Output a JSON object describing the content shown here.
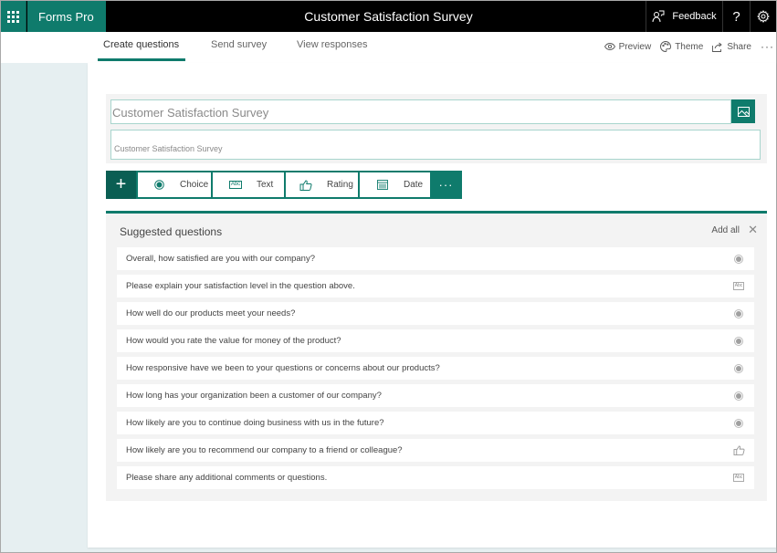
{
  "topbar": {
    "brand": "Forms Pro",
    "title": "Customer Satisfaction Survey",
    "feedback_label": "Feedback",
    "help_label": "?"
  },
  "nav": {
    "tabs": [
      {
        "label": "Create questions",
        "active": true
      },
      {
        "label": "Send survey",
        "active": false
      },
      {
        "label": "View responses",
        "active": false
      }
    ],
    "actions": {
      "preview": "Preview",
      "theme": "Theme",
      "share": "Share",
      "more": "···"
    }
  },
  "form": {
    "title_value": "Customer Satisfaction Survey",
    "subtitle_value": "Customer Satisfaction Survey"
  },
  "question_types": {
    "add": "+",
    "choice": "Choice",
    "text": "Text",
    "rating": "Rating",
    "date": "Date",
    "more": "···"
  },
  "suggested": {
    "title": "Suggested questions",
    "add_all": "Add all",
    "close": "✕",
    "items": [
      {
        "text": "Overall, how satisfied are you with our company?",
        "icon": "choice-icon"
      },
      {
        "text": "Please explain your satisfaction level in the question above.",
        "icon": "text-icon"
      },
      {
        "text": "How well do our products meet your needs?",
        "icon": "choice-icon"
      },
      {
        "text": "How would you rate the value for money of the product?",
        "icon": "choice-icon"
      },
      {
        "text": "How responsive have we been to your questions or concerns about our products?",
        "icon": "choice-icon"
      },
      {
        "text": "How long has your organization been a customer of our company?",
        "icon": "choice-icon"
      },
      {
        "text": "How likely are you to continue doing business with us in the future?",
        "icon": "choice-icon"
      },
      {
        "text": "How likely are you to recommend our company to a friend or colleague?",
        "icon": "rating-icon"
      },
      {
        "text": "Please share any additional comments or questions.",
        "icon": "text-icon"
      }
    ]
  },
  "colors": {
    "brand": "#0f7b6c",
    "brand_dark": "#0a5e53",
    "topbar": "#000000"
  },
  "icon_glyphs": {
    "abc": "Abc"
  }
}
